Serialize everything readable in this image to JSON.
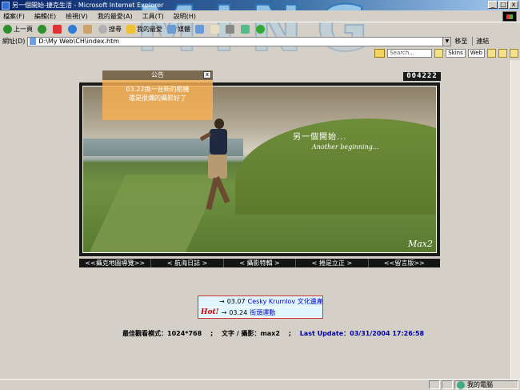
{
  "window": {
    "title": "另一個開始-捷克生活 - Microsoft Internet Explorer",
    "buttons": {
      "minimize": "_",
      "maximize": "□",
      "close": "x"
    }
  },
  "brand": {
    "letters": "MING"
  },
  "menu": {
    "items": [
      {
        "label": "檔案(F)"
      },
      {
        "label": "編輯(E)"
      },
      {
        "label": "檢視(V)"
      },
      {
        "label": "我的最愛(A)"
      },
      {
        "label": "工具(T)"
      },
      {
        "label": "說明(H)"
      }
    ]
  },
  "toolbar": {
    "back": "上一頁",
    "search": "搜尋",
    "favorites": "我的最愛",
    "history": "媒體"
  },
  "address": {
    "label": "網址(D)",
    "value": "D:\\My Web\\CH\\index.htm",
    "go": "移至",
    "links": "連結"
  },
  "searchbar": {
    "placeholder": "Search...",
    "chips": [
      "Skins",
      "Web"
    ]
  },
  "page": {
    "counter": "004222",
    "notice": {
      "title": "公告",
      "close": "x",
      "line1": "03.22換一台新的相機",
      "line2": "還是很爛的攝影好了"
    },
    "photo": {
      "caption_zh": "另一個開始...",
      "caption_en": "Another beginning...",
      "signature": "Max2"
    },
    "nav": [
      {
        "label": "<<攝克地圖導覽>>"
      },
      {
        "label": "< 航海日誌 >"
      },
      {
        "label": "< 攝影特輯 >"
      },
      {
        "label": "< 捲是立正 >"
      },
      {
        "label": "<<留言版>>"
      }
    ],
    "updates": [
      {
        "arrow": "→",
        "date": "03.07",
        "title": "Cesky Krumlov 文化遺產",
        "hot": ""
      },
      {
        "arrow": "→",
        "date": "03.24",
        "title": "街頭運動",
        "hot": "Hot!"
      }
    ],
    "footer": {
      "best_view": "最佳觀看模式：1024*768",
      "credit": "文字 / 攝影：max2",
      "last_update": "Last Update：03/31/2004 17:26:58",
      "sep": ";"
    }
  },
  "status": {
    "text": "",
    "zone": "我的電腦"
  }
}
